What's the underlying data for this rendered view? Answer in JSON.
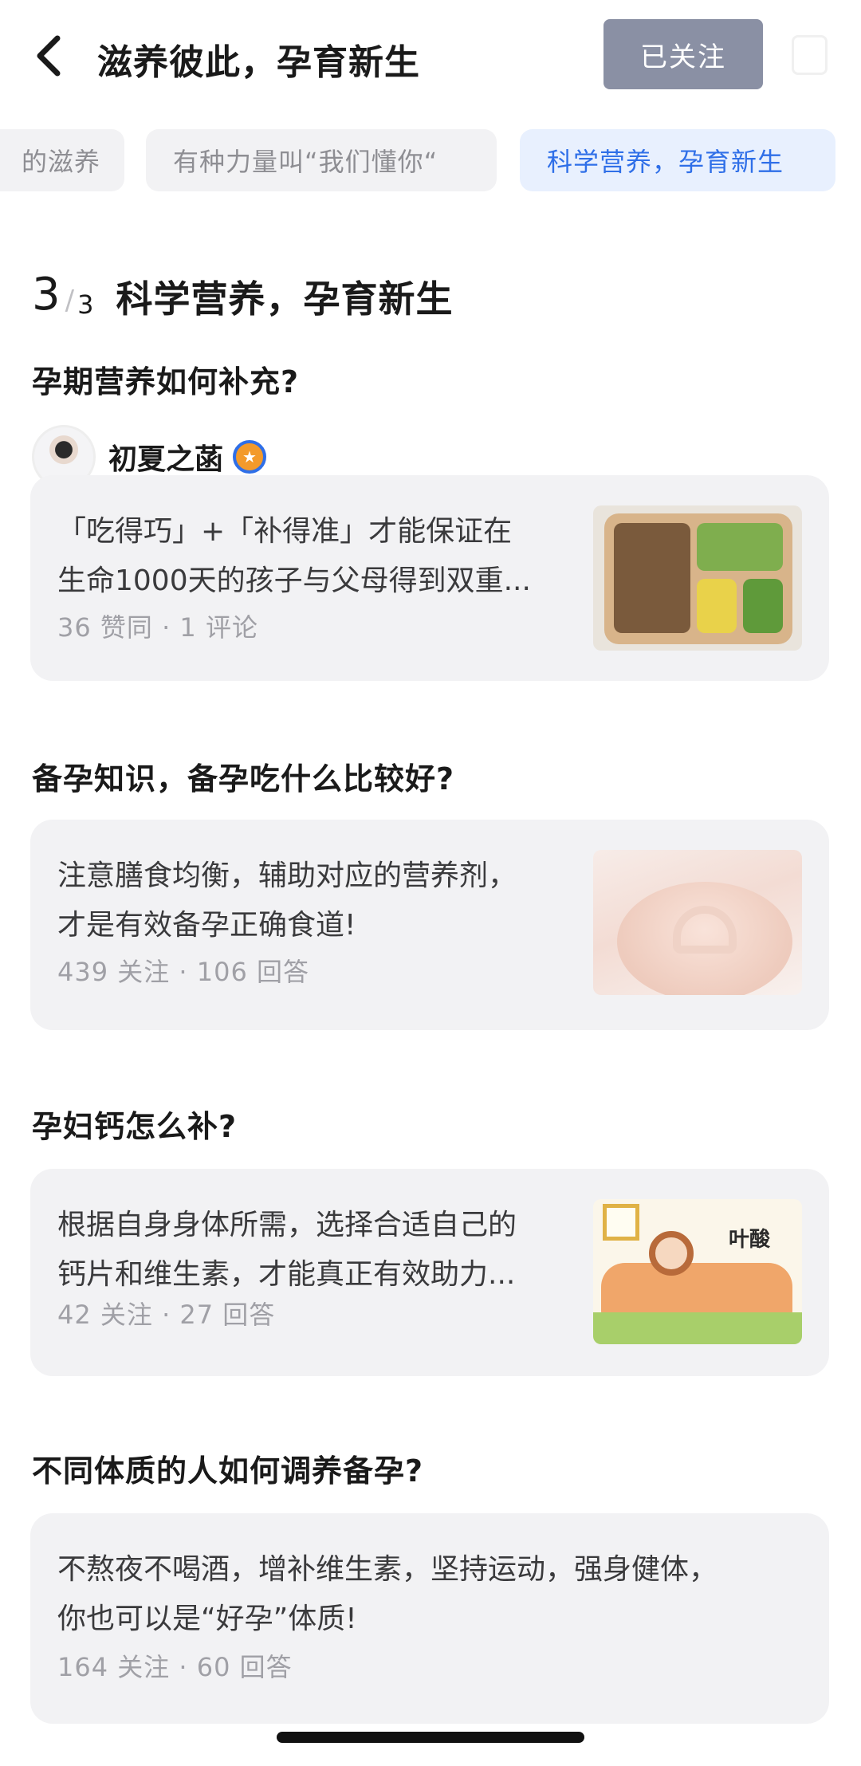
{
  "header": {
    "title": "滋养彼此，孕育新生",
    "follow_label": "已关注"
  },
  "tabs": [
    {
      "label": "的滋养",
      "active": false
    },
    {
      "label": "有种力量叫“我们懂你“",
      "active": false
    },
    {
      "label": "科学营养，孕育新生",
      "active": true
    }
  ],
  "section": {
    "index": "3",
    "total": "3",
    "title": "科学营养，孕育新生"
  },
  "items": [
    {
      "question": "孕期营养如何补充?",
      "author": "初夏之菡",
      "text_lines": [
        "「吃得巧」+「补得准」才能保证在",
        "生命1000天的孩子与父母得到双重..."
      ],
      "meta": "36 赞同 · 1 评论",
      "thumb_icon": "food-tray-image"
    },
    {
      "question": "备孕知识，备孕吃什么比较好?",
      "text_lines": [
        "注意膳食均衡，辅助对应的营养剂，",
        "才是有效备孕正确食道!"
      ],
      "meta": "439 关注 · 106 回答",
      "thumb_icon": "heart-hands-belly-image"
    },
    {
      "question": "孕妇钙怎么补?",
      "text_lines": [
        "根据自身身体所需，选择合适自己的",
        "钙片和维生素，才能真正有效助力..."
      ],
      "meta": "42 关注 · 27 回答",
      "thumb_icon": "mother-illustration-image",
      "thumb_label": "叶酸"
    },
    {
      "question": "不同体质的人如何调养备孕?",
      "text_lines": [
        "不熬夜不喝酒，增补维生素，坚持运动，强身健体，",
        "你也可以是“好孕”体质!"
      ],
      "meta": "164 关注 · 60 回答"
    }
  ],
  "colors": {
    "accent": "#2f6fe8",
    "follow_bg": "#8a90a4",
    "card_bg": "#f2f2f4",
    "meta_text": "#a0a0a6"
  }
}
